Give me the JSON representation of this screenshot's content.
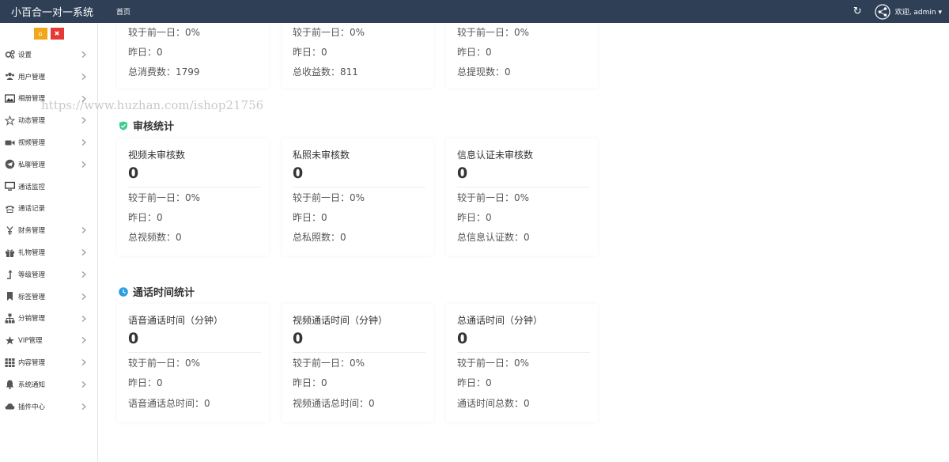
{
  "header": {
    "brand": "小百合一对一系统",
    "home_tab": "首页",
    "welcome": "欢迎, admin ▾"
  },
  "sidebar": {
    "items": [
      {
        "label": "设置",
        "icon": "gears-icon"
      },
      {
        "label": "用户管理",
        "icon": "users-icon"
      },
      {
        "label": "相册管理",
        "icon": "image-icon"
      },
      {
        "label": "动态管理",
        "icon": "star-outline-icon"
      },
      {
        "label": "视频管理",
        "icon": "video-camera-icon"
      },
      {
        "label": "私聊管理",
        "icon": "telegram-icon"
      },
      {
        "label": "通话监控",
        "icon": "monitor-icon"
      },
      {
        "label": "通话记录",
        "icon": "phone-record-icon"
      },
      {
        "label": "财务管理",
        "icon": "yen-icon"
      },
      {
        "label": "礼物管理",
        "icon": "gift-icon"
      },
      {
        "label": "等级管理",
        "icon": "level-up-icon"
      },
      {
        "label": "标签管理",
        "icon": "bookmark-icon"
      },
      {
        "label": "分销管理",
        "icon": "sitemap-icon"
      },
      {
        "label": "VIP管理",
        "icon": "star-icon"
      },
      {
        "label": "内容管理",
        "icon": "grid-icon"
      },
      {
        "label": "系统通知",
        "icon": "bell-icon"
      },
      {
        "label": "插件中心",
        "icon": "cloud-icon"
      }
    ]
  },
  "top_cards": [
    {
      "compare": "较于前一日：0%",
      "yesterday": "昨日：0",
      "total": "总消费数：1799"
    },
    {
      "compare": "较于前一日：0%",
      "yesterday": "昨日：0",
      "total": "总收益数：811"
    },
    {
      "compare": "较于前一日：0%",
      "yesterday": "昨日：0",
      "total": "总提现数：0"
    }
  ],
  "audit": {
    "title": "审核统计",
    "cards": [
      {
        "title": "视频未审核数",
        "value": "0",
        "compare": "较于前一日：0%",
        "yesterday": "昨日：0",
        "total": "总视频数：0"
      },
      {
        "title": "私照未审核数",
        "value": "0",
        "compare": "较于前一日：0%",
        "yesterday": "昨日：0",
        "total": "总私照数：0"
      },
      {
        "title": "信息认证未审核数",
        "value": "0",
        "compare": "较于前一日：0%",
        "yesterday": "昨日：0",
        "total": "总信息认证数：0"
      }
    ]
  },
  "calls": {
    "title": "通话时间统计",
    "cards": [
      {
        "title": "语音通话时间（分钟）",
        "value": "0",
        "compare": "较于前一日：0%",
        "yesterday": "昨日：0",
        "total": "语音通话总时间：0"
      },
      {
        "title": "视频通话时间（分钟）",
        "value": "0",
        "compare": "较于前一日：0%",
        "yesterday": "昨日：0",
        "total": "视频通话总时间：0"
      },
      {
        "title": "总通话时间（分钟）",
        "value": "0",
        "compare": "较于前一日：0%",
        "yesterday": "昨日：0",
        "total": "通话时间总数：0"
      }
    ]
  },
  "watermark": "https://www.huzhan.com/ishop21756",
  "colors": {
    "header_bg": "#2f4056",
    "audit_icon": "#3ecb8e",
    "calls_icon": "#2d9fe0",
    "home_btn": "#f0a81a",
    "delete_btn": "#e53935"
  }
}
